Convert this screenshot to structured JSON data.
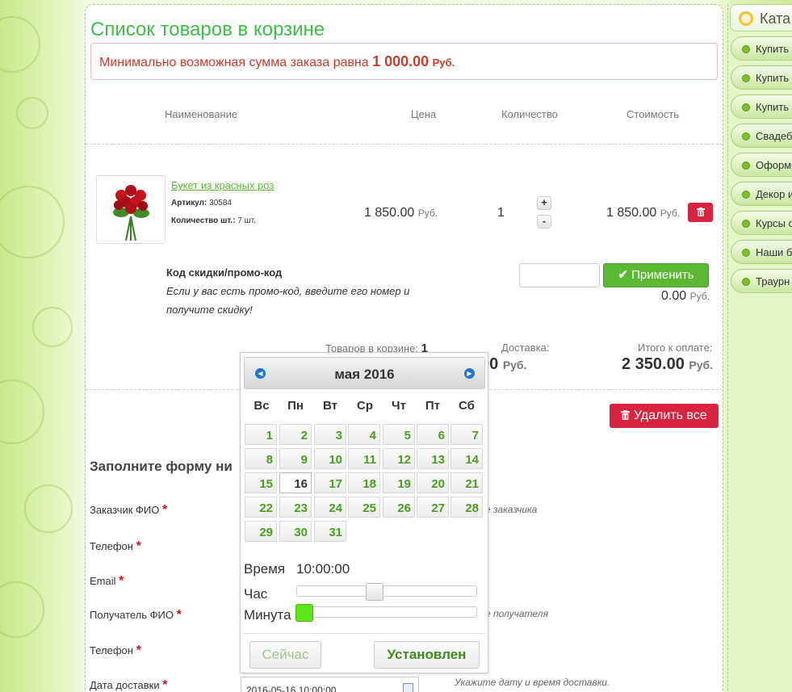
{
  "page_title": "Список товаров в корзине",
  "notice": {
    "text": "Минимально возможная сумма заказа равна",
    "amount": "1 000.00",
    "currency": "Руб."
  },
  "table_headers": {
    "name": "Наименование",
    "price": "Цена",
    "qty": "Количество",
    "cost": "Стоимость"
  },
  "product": {
    "name": "Букет из красных роз",
    "sku_label": "Артикул:",
    "sku": "30584",
    "count_label": "Количество шт.:",
    "count": "7 шт.",
    "price": "1 850.00",
    "currency": "Руб.",
    "qty": "1",
    "plus": "+",
    "minus": "-",
    "cost": "1 850.00",
    "delete_icon": "trash-icon"
  },
  "promo": {
    "title": "Код скидки/промо-код",
    "text": "Если у вас есть промо-код, введите его номер и получите скидку!",
    "apply_label": "Применить",
    "discount": "0.00",
    "currency": "Руб."
  },
  "summary": {
    "items_label": "Товаров в корзине:",
    "items": "1",
    "delivery_label": "Доставка:",
    "delivery": "0.00",
    "delivery_partial": "00",
    "total_label": "Итого к оплате:",
    "total": "2 350.00",
    "currency": "Руб."
  },
  "delete_all_label": "Удалить все",
  "form": {
    "title": "Заполните форму ни",
    "fields": [
      {
        "label": "Заказчик ФИО",
        "hint": "е заказчика"
      },
      {
        "label": "Телефон",
        "hint": ""
      },
      {
        "label": "Email",
        "hint": ""
      },
      {
        "label": "Получатель ФИО",
        "hint": "е получателя"
      },
      {
        "label": "Телефон",
        "hint": ""
      },
      {
        "label": "Дата доставки",
        "hint": "Укажите дату и время доставки."
      }
    ],
    "required_mark": "*",
    "date_value": "2016-05-16 10:00:00"
  },
  "datepicker": {
    "month_title": "мая 2016",
    "weekdays": [
      "Вс",
      "Пн",
      "Вт",
      "Ср",
      "Чт",
      "Пт",
      "Сб"
    ],
    "days": [
      "1",
      "2",
      "3",
      "4",
      "5",
      "6",
      "7",
      "8",
      "9",
      "10",
      "11",
      "12",
      "13",
      "14",
      "15",
      "16",
      "17",
      "18",
      "19",
      "20",
      "21",
      "22",
      "23",
      "24",
      "25",
      "26",
      "27",
      "28",
      "29",
      "30",
      "31"
    ],
    "today": "16",
    "time_label": "Время",
    "time_value": "10:00:00",
    "hour_label": "Час",
    "minute_label": "Минута",
    "hour_fraction": 0.42,
    "minute_fraction": 0.0,
    "now_label": "Сейчас",
    "set_label": "Установлен"
  },
  "sidebar": {
    "title": "Ката",
    "items": [
      "Купить",
      "Купить",
      "Купить",
      "Свадеб",
      "Оформ",
      "Декор и",
      "Курсы с",
      "Наши б",
      "Траурн"
    ]
  },
  "colors": {
    "accent_green": "#3fbf4a",
    "danger": "#d9233f",
    "link_green": "#5cb82e"
  }
}
